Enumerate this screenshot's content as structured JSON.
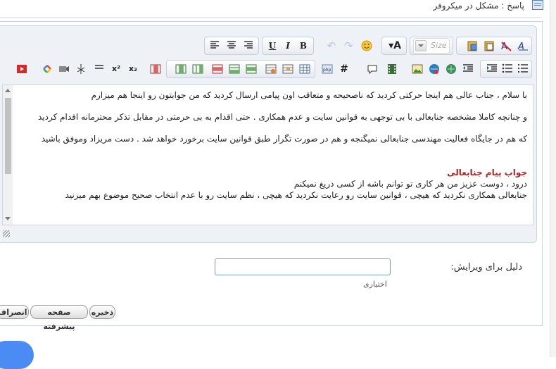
{
  "header": {
    "title": "پاسخ : مشکل در میکروفر",
    "icon": "document-icon"
  },
  "toolbar": {
    "row1": {
      "font_size_placeholder": "Size",
      "buttons": [
        {
          "name": "align-left-icon",
          "glyph": "≡"
        },
        {
          "name": "align-center-icon",
          "glyph": "≡"
        },
        {
          "name": "align-right-icon",
          "glyph": "≡"
        },
        {
          "name": "underline-button",
          "glyph": "U"
        },
        {
          "name": "italic-button",
          "glyph": "I"
        },
        {
          "name": "bold-button",
          "glyph": "B"
        },
        {
          "name": "undo-icon",
          "glyph": "↶"
        },
        {
          "name": "redo-icon",
          "glyph": "↷"
        },
        {
          "name": "smiley-icon",
          "glyph": "☺"
        },
        {
          "name": "font-color-button",
          "glyph": "A"
        },
        {
          "name": "paste-icon",
          "glyph": ""
        },
        {
          "name": "paste-text-icon",
          "glyph": ""
        },
        {
          "name": "remove-format-icon",
          "glyph": "A"
        },
        {
          "name": "text-direction-icon",
          "glyph": "A"
        }
      ]
    },
    "row2_icons": [
      "youtube-icon",
      "google-icon",
      "video-icon",
      "tree-icon",
      "horizontal-rule-icon",
      "superscript-icon",
      "subscript-icon",
      "table-column-icon",
      "table-insert-column-icon",
      "table-column-delete-icon",
      "table-row-icon",
      "table-insert-row-icon",
      "table-row-delete-icon",
      "table-cell-icon",
      "table-merge-icon",
      "table-icon",
      "php-icon",
      "hash-icon",
      "quote-icon",
      "film-icon",
      "image-icon",
      "link-icon",
      "unlink-icon",
      "outdent-icon",
      "indent-icon",
      "bullet-list-icon",
      "numbered-list-icon"
    ],
    "superscript_label": "x²",
    "subscript_label": "x₂",
    "hash_label": "#"
  },
  "editor": {
    "paragraphs": [
      "با سلام ، جناب عالی هم اینجا حرکتی کردید که ناصحیحه و متعاقب اون پیامی ارسال کردید که من جوابتون رو اینجا هم میزارم",
      "و چنانچه کاملا مشخصه جنابعالی با بی توجهی به قوانین سایت و عدم همکاری . حتی اقدام به بی حرمتی در مقابل تذکر محترمانه اقدام کردید",
      "که هم در جایگاه فعالیت مهندسی جنابعالی نمیگنجه و هم در صورت تگرار طبق قوانین سایت برخورد خواهد شد . دست مریزاد وموفق باشید"
    ],
    "reply_title": "جواب پیام جنابعالی",
    "reply_lines": [
      "درود ، دوست عزیز من هر کاری تو توانم باشه از کسی دریغ نمیکنم",
      "جنابعالی همکاری نکردید که هیچی ، قوانین سایت رو رعایت نکردید که هیچی ، نظم سایت رو با عدم انتخاب صحیح موضوع بهم میزنید"
    ]
  },
  "form": {
    "reason_label": "دلیل برای ویرایش:",
    "reason_value": "",
    "optional_label": "اختیاری"
  },
  "actions": {
    "save_label": "ذخیره",
    "advanced_label": "صفحه پیشرفته",
    "cancel_label": "انصراف"
  },
  "colors": {
    "accent": "#4a8bf4",
    "reply_title": "#b22222",
    "editor_bg": "#eef1f5"
  }
}
